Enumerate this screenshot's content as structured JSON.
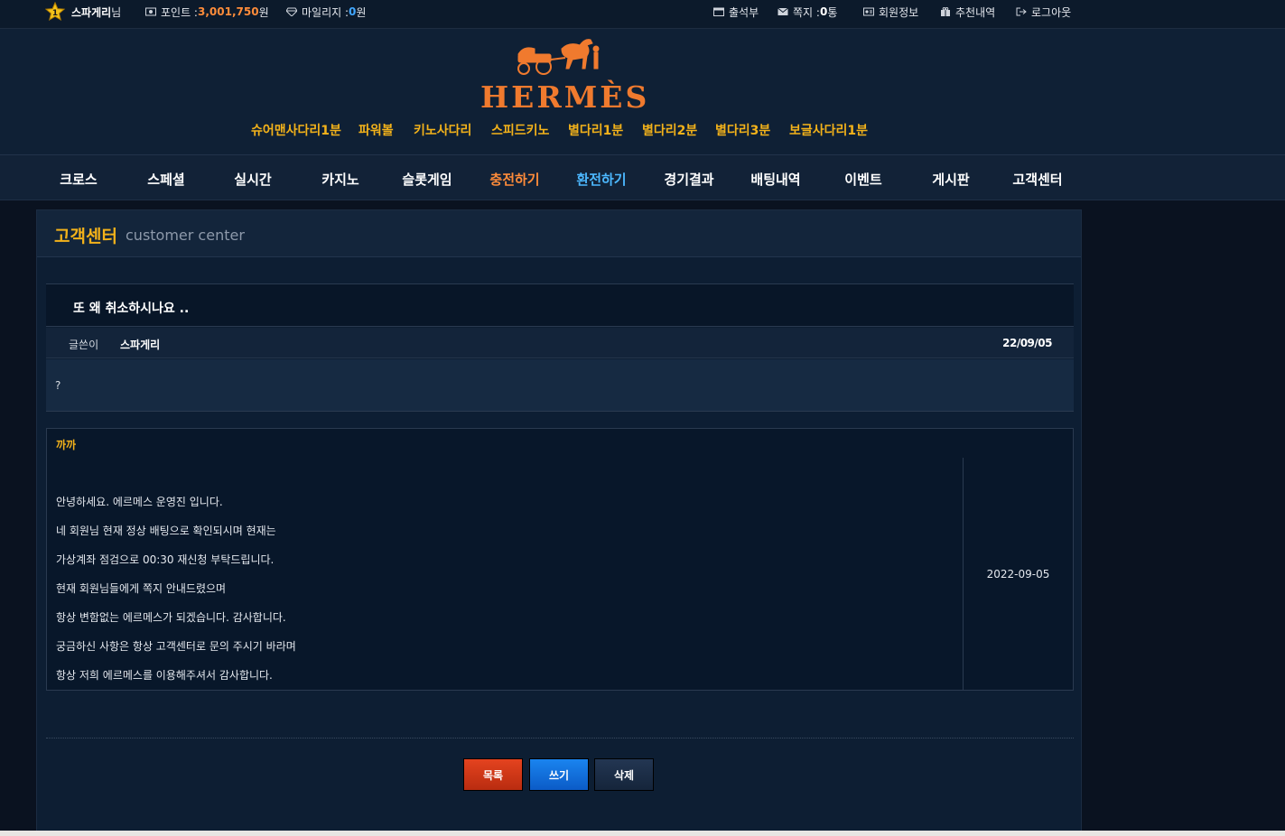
{
  "topbar": {
    "level": "1",
    "username": "스파게리",
    "username_suffix": "님",
    "points_label": "포인트 : ",
    "points_value": "3,001,750",
    "points_unit": "원",
    "mileage_label": "마일리지 : ",
    "mileage_value": "0",
    "mileage_unit": "원",
    "attendance": "출석부",
    "messages_label": "쪽지 : ",
    "messages_count": "0",
    "messages_unit": " 통",
    "member_info": "회원정보",
    "referral": "추천내역",
    "logout": "로그아웃"
  },
  "brand": {
    "logo_text": "HERMÈS"
  },
  "subnav": [
    "슈어맨사다리1분",
    "파워볼",
    "키노사다리",
    "스피드키노",
    "별다리1분",
    "별다리2분",
    "별다리3분",
    "보글사다리1분"
  ],
  "mainnav": [
    "크로스",
    "스페셜",
    "실시간",
    "카지노",
    "슬롯게임",
    "충전하기",
    "환전하기",
    "경기결과",
    "배팅내역",
    "이벤트",
    "게시판",
    "고객센터"
  ],
  "panel": {
    "title": "고객센터",
    "subtitle": "customer center"
  },
  "post": {
    "title": "또 왜 취소하시나요 ..",
    "author_label": "글쓴이",
    "author": "스파게리",
    "date": "22/09/05",
    "body": "?"
  },
  "reply": {
    "author": "까까",
    "lines": [
      "안녕하세요. 에르메스 운영진 입니다.",
      "네 회원님 현재 정상 배팅으로 확인되시며 현재는",
      "가상계좌 점검으로 00:30 재신청 부탁드립니다.",
      "현재 회원님들에게 쪽지 안내드렸으며",
      "항상 변함없는 에르메스가 되겠습니다. 감사합니다.",
      "궁금하신 사항은 항상 고객센터로 문의 주시기 바라며",
      "항상 저희 에르메스를 이용해주셔서 감사합니다."
    ],
    "date": "2022-09-05"
  },
  "buttons": {
    "list": "목록",
    "write": "쓰기",
    "delete": "삭제"
  },
  "colors": {
    "accent_gold": "#f3b21a",
    "accent_orange": "#ff8c3a",
    "accent_cyan": "#4cb8ff",
    "logo_orange": "#f07a2e"
  }
}
